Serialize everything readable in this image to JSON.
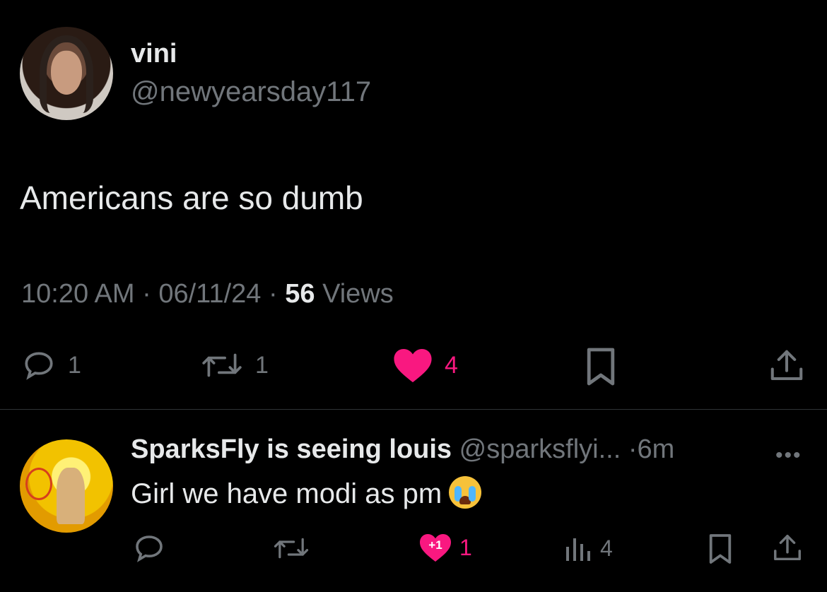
{
  "tweet": {
    "author_name": "vini",
    "author_handle": "@newyearsday117",
    "text": "Americans are so dumb",
    "time": "10:20 AM",
    "date": "06/11/24",
    "views_count": "56",
    "views_label": "Views",
    "reply_count": "1",
    "retweet_count": "1",
    "like_count": "4"
  },
  "reply": {
    "author_name": "SparksFly is seeing louis",
    "author_handle": "@sparksflyi...",
    "age": "6m",
    "text": "Girl we have modi as pm",
    "like_badge": "+1",
    "like_count": "1",
    "views_count": "4"
  },
  "colors": {
    "background": "#000000",
    "text": "#e7e9ea",
    "muted": "#71767b",
    "like": "#f91880"
  },
  "icons": [
    "reply-icon",
    "retweet-icon",
    "heart-icon",
    "bookmark-icon",
    "share-icon",
    "more-icon",
    "views-icon",
    "crying-emoji"
  ]
}
